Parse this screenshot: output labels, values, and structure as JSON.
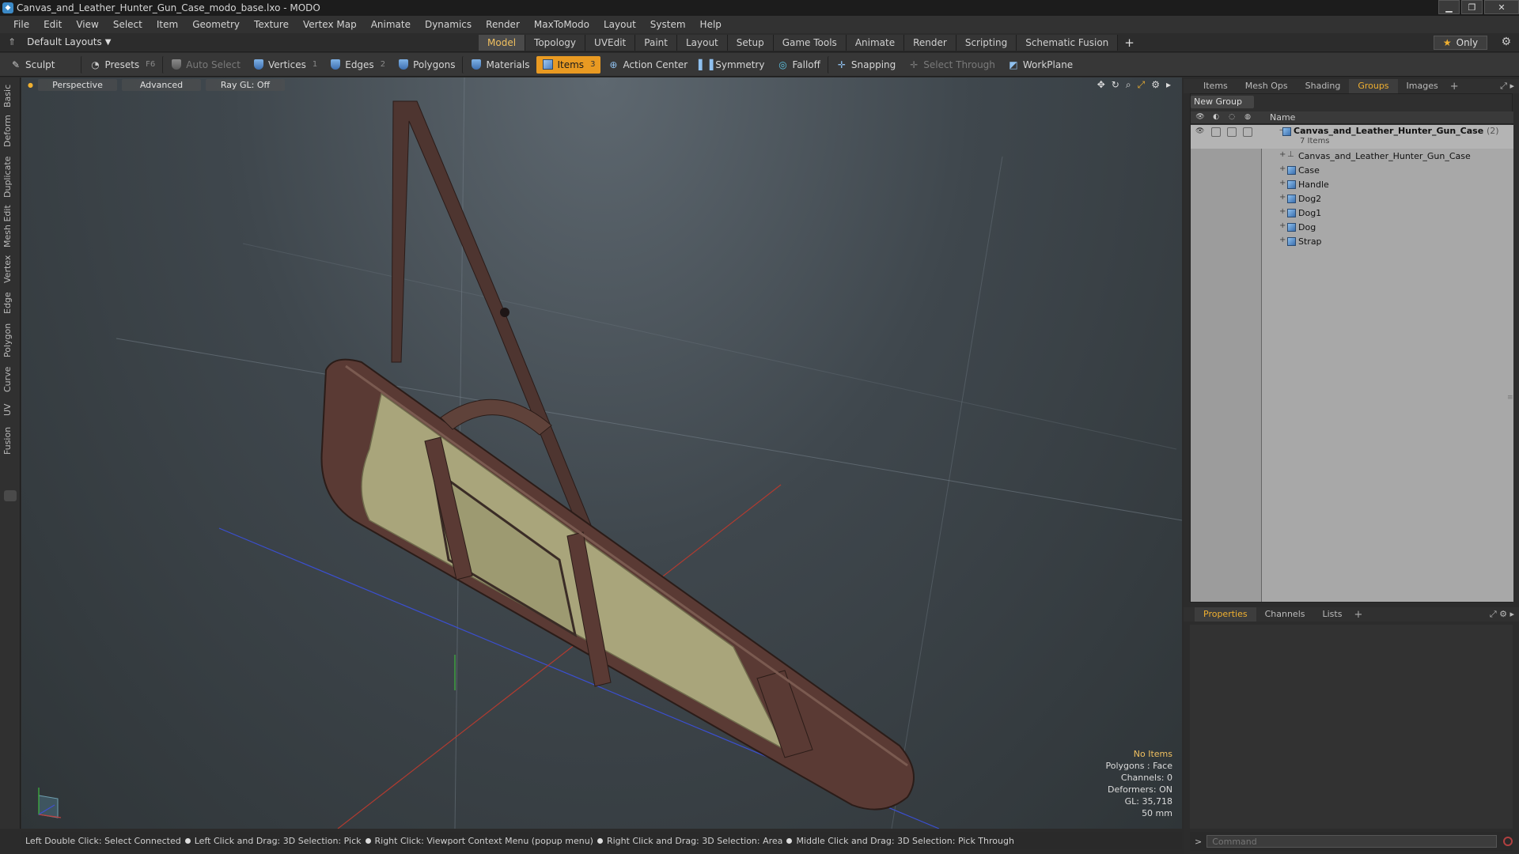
{
  "window": {
    "title": "Canvas_and_Leather_Hunter_Gun_Case_modo_base.lxo - MODO"
  },
  "menu": [
    "File",
    "Edit",
    "View",
    "Select",
    "Item",
    "Geometry",
    "Texture",
    "Vertex Map",
    "Animate",
    "Dynamics",
    "Render",
    "MaxToModo",
    "Layout",
    "System",
    "Help"
  ],
  "layouts": {
    "selector": "Default Layouts",
    "tabs": [
      "Model",
      "Topology",
      "UVEdit",
      "Paint",
      "Layout",
      "Setup",
      "Game Tools",
      "Animate",
      "Render",
      "Scripting",
      "Schematic Fusion"
    ],
    "active": "Model",
    "only": "Only"
  },
  "toolbar": {
    "sculpt": "Sculpt",
    "presets": "Presets",
    "presets_key": "F6",
    "auto_select": "Auto Select",
    "vertices": "Vertices",
    "vertices_key": "1",
    "edges": "Edges",
    "edges_key": "2",
    "polygons": "Polygons",
    "materials": "Materials",
    "items": "Items",
    "action_center": "Action Center",
    "symmetry": "Symmetry",
    "falloff": "Falloff",
    "snapping": "Snapping",
    "select_through": "Select Through",
    "workplane": "WorkPlane"
  },
  "left_tabs": [
    "Basic",
    "Deform",
    "Duplicate",
    "Mesh Edit",
    "Vertex",
    "Edge",
    "Polygon",
    "Curve",
    "UV",
    "Fusion"
  ],
  "viewport": {
    "view": "Perspective",
    "shading": "Advanced",
    "raygl": "Ray GL: Off",
    "info": {
      "no_items": "No Items",
      "polygons": "Polygons : Face",
      "channels": "Channels: 0",
      "deformers": "Deformers: ON",
      "gl": "GL: 35,718",
      "size": "50 mm"
    }
  },
  "status": [
    "Left Double Click: Select Connected",
    "Left Click and Drag: 3D Selection: Pick",
    "Right Click: Viewport Context Menu (popup menu)",
    "Right Click and Drag: 3D Selection: Area",
    "Middle Click and Drag: 3D Selection: Pick Through"
  ],
  "panel_tabs": {
    "top": [
      "Items",
      "Mesh Ops",
      "Shading",
      "Groups",
      "Images"
    ],
    "top_active": "Groups",
    "bottom": [
      "Properties",
      "Channels",
      "Lists"
    ],
    "bottom_active": "Properties"
  },
  "groups": {
    "new_group": "New Group",
    "column": "Name",
    "group_name": "Canvas_and_Leather_Hunter_Gun_Case",
    "group_count": "(2)",
    "group_sub": "7 Items",
    "items": [
      "Canvas_and_Leather_Hunter_Gun_Case",
      "Case",
      "Handle",
      "Dog2",
      "Dog1",
      "Dog",
      "Strap"
    ]
  },
  "command": {
    "placeholder": "Command"
  },
  "colors": {
    "accent": "#e99a22",
    "active_tab_text": "#f0b030",
    "info_highlight": "#f0c060"
  }
}
